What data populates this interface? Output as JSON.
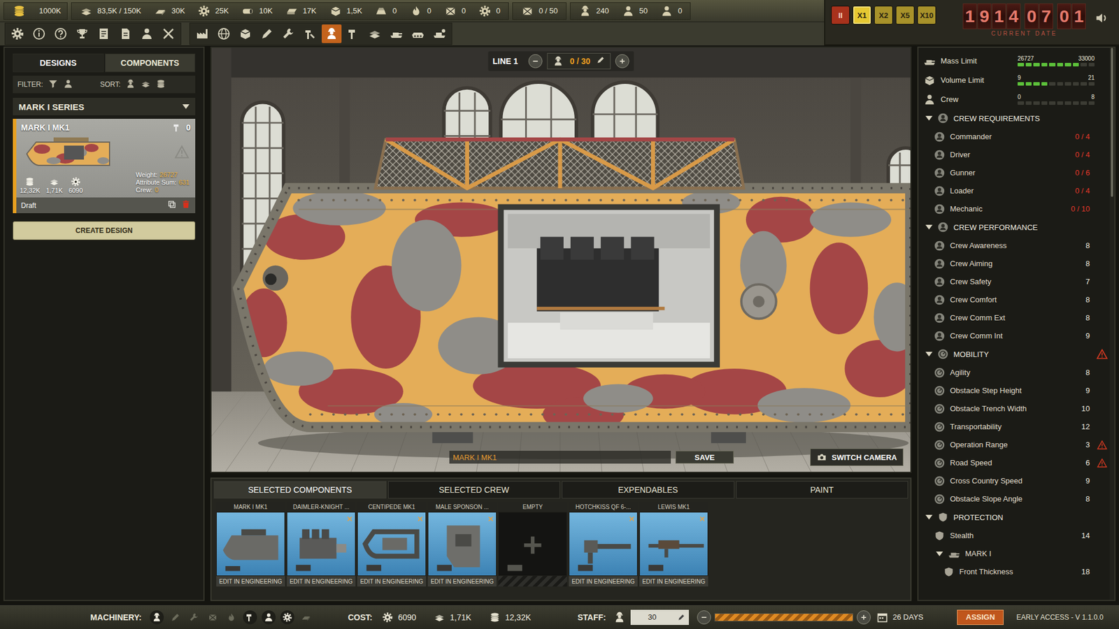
{
  "top_bar": {
    "money": "1000K",
    "materials": [
      "83,5K / 150K",
      "30K",
      "25K",
      "10K",
      "17K",
      "1,5K",
      "0",
      "0",
      "0",
      "0"
    ],
    "storage": "0 / 50",
    "staff": [
      "240",
      "50",
      "0"
    ]
  },
  "toolbar": [
    {
      "selected": false
    },
    {
      "selected": false
    },
    {
      "selected": false
    },
    {
      "selected": false
    },
    {
      "selected": false
    },
    {
      "selected": false
    },
    {
      "selected": false
    },
    {
      "selected": false
    },
    {
      "selected": false
    },
    {
      "selected": false
    },
    {
      "selected": false
    },
    {
      "selected": false
    },
    {
      "selected": false
    },
    {
      "selected": false
    },
    {
      "selected": true
    },
    {
      "selected": false
    },
    {
      "selected": false
    },
    {
      "selected": false
    },
    {
      "selected": false
    },
    {
      "selected": false
    }
  ],
  "speed_buttons": [
    {
      "label": "II",
      "selected": false
    },
    {
      "label": "X1",
      "selected": true
    },
    {
      "label": "X2",
      "selected": false
    },
    {
      "label": "X5",
      "selected": false
    },
    {
      "label": "X10",
      "selected": false
    }
  ],
  "date": {
    "groups": [
      [
        "1",
        "9",
        "1",
        "4"
      ],
      [
        "0",
        "7"
      ],
      [
        "0",
        "1"
      ]
    ],
    "label": "CURRENT DATE"
  },
  "left_panel": {
    "tabs": [
      {
        "label": "DESIGNS",
        "selected": true
      },
      {
        "label": "COMPONENTS",
        "selected": false
      }
    ],
    "filter_label": "FILTER:",
    "sort_label": "SORT:",
    "series": {
      "title": "MARK I SERIES",
      "expanded": true
    },
    "card": {
      "title": "MARK I MK1",
      "count": "0",
      "weight_label": "Weight:",
      "weight": "26727",
      "attr_label": "Attribute Sum:",
      "attr": "631",
      "crew_label": "Crew:",
      "crew": "0",
      "stats": [
        "12,32K",
        "1,71K",
        "6090"
      ],
      "status": "Draft",
      "selected": true
    },
    "create_button": "CREATE DESIGN"
  },
  "line": {
    "label": "LINE 1",
    "workers": "0 / 30"
  },
  "viewport": {
    "design_name": "MARK I MK1",
    "save": "SAVE",
    "switch_camera": "SWITCH CAMERA"
  },
  "bottom_tabs": [
    {
      "label": "SELECTED COMPONENTS",
      "selected": true
    },
    {
      "label": "SELECTED CREW",
      "selected": false
    },
    {
      "label": "EXPENDABLES",
      "selected": false
    },
    {
      "label": "PAINT",
      "selected": false
    }
  ],
  "components": [
    {
      "kind": "filled",
      "name": "MARK I MK1",
      "action": "EDIT IN ENGINEERING",
      "removable": false
    },
    {
      "kind": "filled",
      "name": "DAIMLER-KNIGHT ...",
      "action": "EDIT IN ENGINEERING",
      "removable": true
    },
    {
      "kind": "filled",
      "name": "CENTIPEDE MK1",
      "action": "EDIT IN ENGINEERING",
      "removable": true
    },
    {
      "kind": "filled",
      "name": "MALE SPONSON ...",
      "action": "EDIT IN ENGINEERING",
      "removable": true
    },
    {
      "kind": "empty",
      "name": "EMPTY",
      "removable": false
    },
    {
      "kind": "filled",
      "name": "HOTCHKISS QF 6-...",
      "action": "EDIT IN ENGINEERING",
      "removable": true
    },
    {
      "kind": "filled",
      "name": "LEWIS MK1",
      "action": "EDIT IN ENGINEERING",
      "removable": true
    }
  ],
  "limits": [
    {
      "label": "Mass Limit",
      "value": "26727",
      "max": "33000",
      "level": 0.81
    },
    {
      "label": "Volume Limit",
      "value": "9",
      "max": "21",
      "level": 0.43
    },
    {
      "label": "Crew",
      "value": "0",
      "max": "8",
      "level": 0
    }
  ],
  "sections": [
    {
      "title": "CREW REQUIREMENTS",
      "expanded": true,
      "warning": false,
      "rows": [
        {
          "kind": "stat",
          "label": "Commander",
          "value": "0 / 4",
          "alert": true,
          "warning": false
        },
        {
          "kind": "stat",
          "label": "Driver",
          "value": "0 / 4",
          "alert": true,
          "warning": false
        },
        {
          "kind": "stat",
          "label": "Gunner",
          "value": "0 / 6",
          "alert": true,
          "warning": false
        },
        {
          "kind": "stat",
          "label": "Loader",
          "value": "0 / 4",
          "alert": true,
          "warning": false
        },
        {
          "kind": "stat",
          "label": "Mechanic",
          "value": "0 / 10",
          "alert": true,
          "warning": false
        }
      ]
    },
    {
      "title": "CREW PERFORMANCE",
      "expanded": true,
      "warning": false,
      "rows": [
        {
          "kind": "stat",
          "label": "Crew Awareness",
          "value": "8",
          "alert": false,
          "warning": false
        },
        {
          "kind": "stat",
          "label": "Crew Aiming",
          "value": "8",
          "alert": false,
          "warning": false
        },
        {
          "kind": "stat",
          "label": "Crew Safety",
          "value": "7",
          "alert": false,
          "warning": false
        },
        {
          "kind": "stat",
          "label": "Crew Comfort",
          "value": "8",
          "alert": false,
          "warning": false
        },
        {
          "kind": "stat",
          "label": "Crew Comm Ext",
          "value": "8",
          "alert": false,
          "warning": false
        },
        {
          "kind": "stat",
          "label": "Crew Comm Int",
          "value": "9",
          "alert": false,
          "warning": false
        }
      ]
    },
    {
      "title": "MOBILITY",
      "expanded": true,
      "warning": true,
      "rows": [
        {
          "kind": "stat",
          "label": "Agility",
          "value": "8",
          "alert": false,
          "warning": false
        },
        {
          "kind": "stat",
          "label": "Obstacle Step Height",
          "value": "9",
          "alert": false,
          "warning": false
        },
        {
          "kind": "stat",
          "label": "Obstacle Trench Width",
          "value": "10",
          "alert": false,
          "warning": false
        },
        {
          "kind": "stat",
          "label": "Transportability",
          "value": "12",
          "alert": false,
          "warning": false
        },
        {
          "kind": "stat",
          "label": "Operation Range",
          "value": "3",
          "alert": false,
          "warning": true
        },
        {
          "kind": "stat",
          "label": "Road Speed",
          "value": "6",
          "alert": false,
          "warning": true
        },
        {
          "kind": "stat",
          "label": "Cross Country Speed",
          "value": "9",
          "alert": false,
          "warning": false
        },
        {
          "kind": "stat",
          "label": "Obstacle Slope Angle",
          "value": "8",
          "alert": false,
          "warning": false
        }
      ]
    },
    {
      "title": "PROTECTION",
      "expanded": true,
      "warning": false,
      "rows": [
        {
          "kind": "stat",
          "label": "Stealth",
          "value": "14",
          "alert": false,
          "warning": false
        },
        {
          "kind": "group",
          "label": "MARK I",
          "expanded": true
        },
        {
          "kind": "stat",
          "label": "Front Thickness",
          "value": "18",
          "alert": false,
          "warning": false
        }
      ]
    }
  ],
  "scrollbar": {
    "level": 0.27
  },
  "footer": {
    "machinery_label": "MACHINERY:",
    "machinery": [
      {
        "active": true
      },
      {
        "active": false
      },
      {
        "active": false
      },
      {
        "active": false
      },
      {
        "active": false
      },
      {
        "active": true
      },
      {
        "active": true
      },
      {
        "active": true
      },
      {
        "active": false
      }
    ],
    "cost_label": "COST:",
    "costs": [
      "6090",
      "1,71K",
      "12,32K"
    ],
    "staff_label": "STAFF:",
    "staff": "30",
    "staff_level": 1.0,
    "days": "26 DAYS",
    "assign": "ASSIGN",
    "version": "EARLY ACCESS - V 1.1.0.0"
  }
}
